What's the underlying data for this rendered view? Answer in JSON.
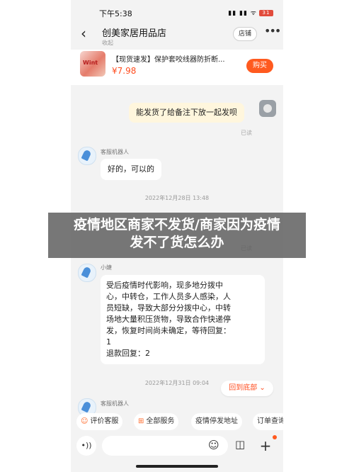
{
  "status": {
    "time": "下午5:38",
    "icons": "▮▮ ▮▮ ᯤ",
    "battery": "31"
  },
  "header": {
    "title": "创美家居用品店",
    "subtitle": "收起",
    "store_label": "店铺",
    "back_icon": "‹",
    "more_icon": "•••"
  },
  "product": {
    "title": "【现货速发】保护套咬线器防折断...",
    "price": "¥7.98",
    "buy_label": "购买",
    "thumb_text": "Wint"
  },
  "messages": {
    "m1": {
      "text": "能发货了给备注下放一起发呗",
      "status": "已读"
    },
    "m2": {
      "sender": "客服机器人",
      "text": "好的，可以的"
    },
    "ts1": "2022年12月28日 13:48",
    "hidden_status": "已读",
    "m3": {
      "sender": "小婕",
      "lines": [
        "受后疫情时代影响，现多地分拨中",
        "心，中转仓，工作人员多人感染，人",
        "员短缺，导致大部分分拨中心，中转",
        "场地大量积压货物，导致合作快递停",
        "发，恢复时间尚未确定，等待回复：",
        "1",
        "退款回复：2"
      ]
    },
    "ts2": "2022年12月31日 09:04",
    "m4": {
      "sender": "客服机器人"
    }
  },
  "back_to_bottom": "回到底部 ⌄",
  "quick_actions": [
    "评价客服",
    "全部服务",
    "疫情停发地址",
    "订单查询"
  ],
  "quick_icons": [
    "☺",
    "⊞"
  ],
  "input": {
    "placeholder": "",
    "voice_icon": "•))",
    "emoji_icon": "☺",
    "bag_icon": "◫",
    "plus_icon": "+"
  },
  "overlay": {
    "line1": "疫情地区商家不发货/商家因为疫情",
    "line2": "发不了货怎么办"
  },
  "colors": {
    "accent": "#ff5a1f",
    "price": "#ff4d1f",
    "bubble_self": "#fff6dd"
  }
}
